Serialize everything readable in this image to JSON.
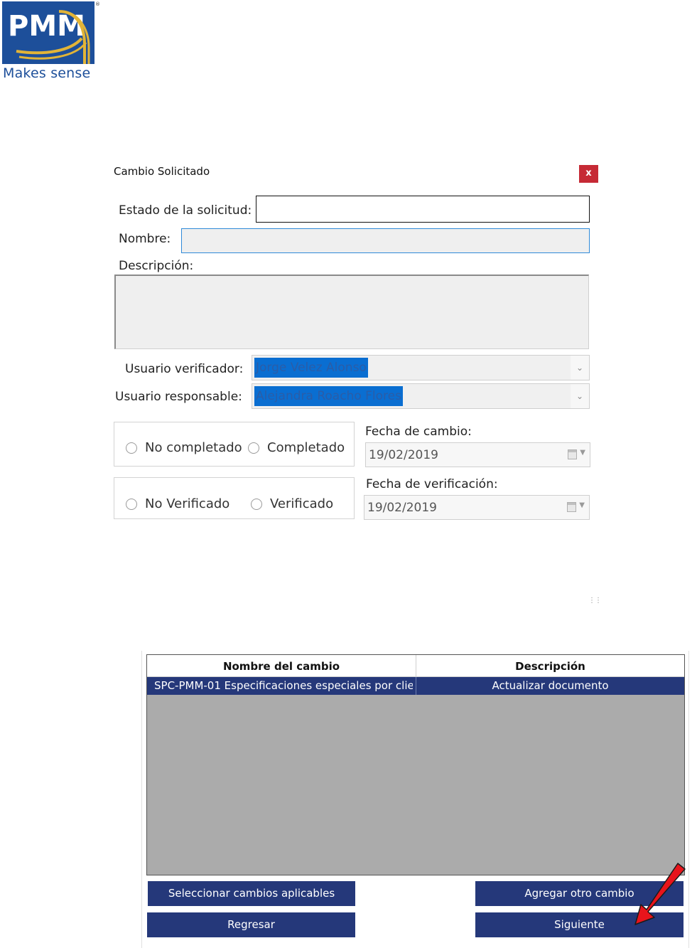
{
  "logo": {
    "wordmark": "PMM",
    "registered": "®",
    "tagline": "Makes sense"
  },
  "dialog": {
    "title": "Cambio Solicitado",
    "close_label": "x",
    "estado_label": "Estado de la solicitud:",
    "estado_value": "",
    "nombre_label": "Nombre:",
    "nombre_value": "",
    "descripcion_label": "Descripción:",
    "descripcion_value": "",
    "verificador_label": "Usuario verificador:",
    "verificador_value": "Jorge Velez Alonso",
    "responsable_label": "Usuario responsable:",
    "responsable_value": "Alejandra Roacho Flores",
    "completion": {
      "option_no": "No completado",
      "option_yes": "Completado"
    },
    "verification": {
      "option_no": "No Verificado",
      "option_yes": "Verificado"
    },
    "fecha_cambio_label": "Fecha de cambio:",
    "fecha_cambio_value": "19/02/2019",
    "fecha_verificacion_label": "Fecha de verificación:",
    "fecha_verificacion_value": "19/02/2019"
  },
  "table": {
    "columns": [
      "Nombre del cambio",
      "Descripción"
    ],
    "rows": [
      {
        "nombre": "SPC-PMM-01 Especificaciones especiales por clie...",
        "descripcion": "Actualizar documento"
      }
    ]
  },
  "buttons": {
    "seleccionar": "Seleccionar cambios aplicables",
    "agregar": "Agregar otro cambio",
    "regresar": "Regresar",
    "siguiente": "Siguiente"
  },
  "colors": {
    "brand_blue": "#1d4f9a",
    "button_navy": "#25387a",
    "close_red": "#c62a35",
    "annotation_arrow": "#e8141b"
  }
}
